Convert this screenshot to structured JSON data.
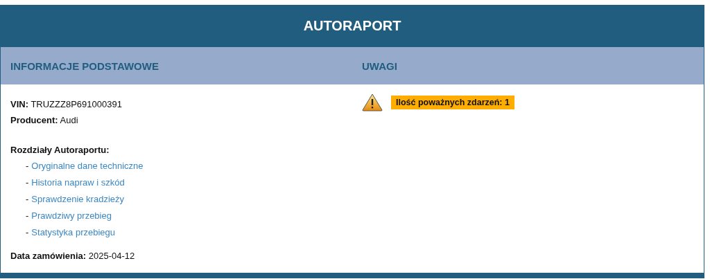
{
  "title": "AUTORAPORT",
  "basic_info": {
    "heading": "INFORMACJE PODSTAWOWE",
    "fields": [
      "**VIN:** TRUZZZ8P691000391",
      "**Producent:** Audi"
    ],
    "sections_label": "Rozdziały Autoraportu:",
    "sections": [
      {
        "dash": "-",
        "link": "Oryginalne dane techniczne"
      },
      {
        "dash": "-",
        "link": "Historia napraw i szkód"
      },
      {
        "dash": "-",
        "link": "Sprawdzenie kradzieży"
      },
      {
        "dash": "-",
        "link": "Prawdziwy przebieg"
      },
      {
        "dash": "-",
        "link": "Statystyka przebiegu"
      }
    ],
    "order_date": "**Data zamówienia:** 2025-04-12"
  },
  "notes": {
    "heading": "UWAGI",
    "items": [
      {
        "kind": "warning",
        "text": "Ilość poważnych zdarzeń: 1"
      }
    ]
  }
}
